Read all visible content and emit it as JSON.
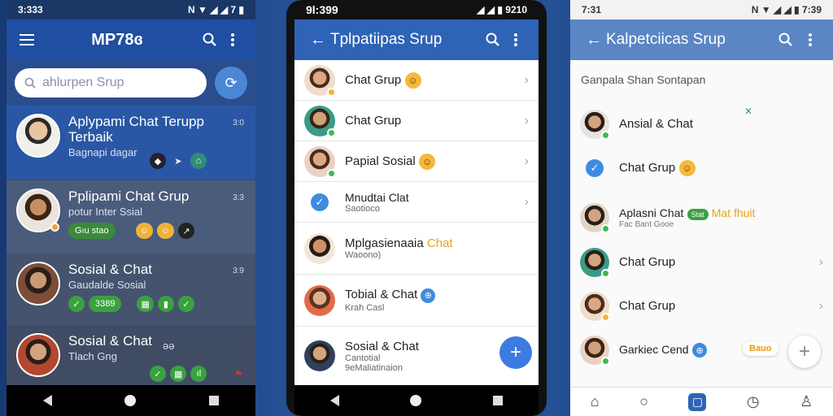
{
  "phone1": {
    "status_time": "3:333",
    "status_icons": "N ▼ ◢ ◢ 7 ▮",
    "title": "MP78ɞ",
    "search_placeholder": "ahlurpen Srup",
    "items": [
      {
        "name": "Aplypami Chat Terupp Terbaik",
        "sub": "Bagnapi dagar",
        "time": "3:0",
        "chips": [
          "◆",
          "➤",
          "⌂"
        ]
      },
      {
        "name": "Pplipami Chat Grup",
        "sub": "potur Inter Ssial",
        "time": "3:3",
        "chips": [
          "Gıu stao",
          "☺",
          "☺",
          "↗"
        ]
      },
      {
        "name": "Sosial & Chat",
        "sub": "Gaudalde Sosial",
        "time": "3:9",
        "chips": [
          "✓",
          "3389",
          "▦",
          "▮",
          "✓"
        ]
      },
      {
        "name": "Sosial & Chat",
        "sub": "Tlach Gng",
        "time": "əə",
        "chips": [
          "✓",
          "▦",
          "ıl",
          "⚑"
        ]
      }
    ]
  },
  "phone2": {
    "status_time": "9l:399",
    "status_icons": "◢ ◢ ▮ 9210",
    "title": "Tplpatiipas Srup",
    "items": [
      {
        "name": "Chat Grup",
        "sub": "",
        "emoji": "😊"
      },
      {
        "name": "Chat Grup",
        "sub": "",
        "emoji": ""
      },
      {
        "name": "Papial Sosial",
        "sub": "",
        "emoji": "😊"
      },
      {
        "name": "Mnudtai Clat",
        "sub": "Saotioco",
        "emoji": ""
      },
      {
        "name": "Mplgasienaaia",
        "highlight": "Chat",
        "sub": "Waoono)",
        "emoji": ""
      },
      {
        "name": "Tobial & Chat",
        "sub": "Krah Casl",
        "emoji": "⊕"
      },
      {
        "name": "Sosial & Chat",
        "sub": "Cantotial",
        "sub2": "9eMaliatinaion",
        "emoji": ""
      }
    ],
    "fab_label": "+"
  },
  "phone3": {
    "status_time": "7:31",
    "status_icons": "N ▼ ◢ ◢ ▮ 7:39",
    "title": "Kalpetciicas Srup",
    "section_title": "Ganpala Shan Sontapan",
    "items": [
      {
        "name": "Ansial & Chat",
        "sub": ""
      },
      {
        "name": "Chat Grup",
        "sub": ""
      },
      {
        "name": "Aplasni Chat",
        "badge": "Stat",
        "highlight": "Mat fhuit",
        "sub": "Fac Bant Gooe"
      },
      {
        "name": "Chat Grup",
        "sub": ""
      },
      {
        "name": "Chat Grup",
        "sub": ""
      },
      {
        "name": "Garkiec Cend",
        "sub": "",
        "pill": "Bauo"
      }
    ],
    "fab_label": "+"
  }
}
